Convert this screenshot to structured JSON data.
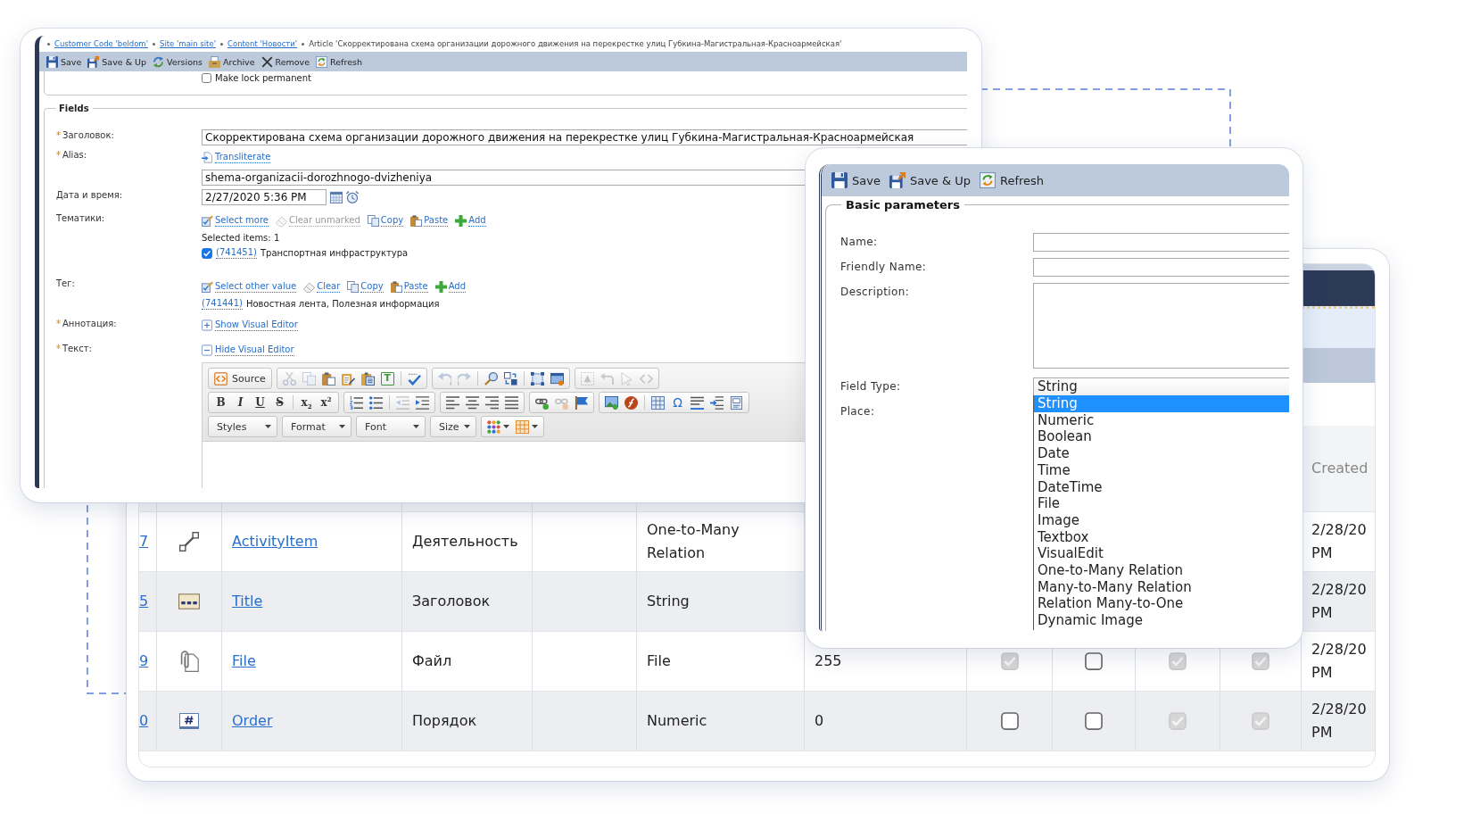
{
  "editor_window": {
    "breadcrumb": [
      {
        "label": "Customer Code 'beldom'",
        "link": true
      },
      {
        "label": "Site 'main site'",
        "link": true
      },
      {
        "label": "Content 'Новости'",
        "link": true
      },
      {
        "label": "Article 'Скорректирована схема организации дорожного движения на перекрестке улиц Губкина-Магистральная-Красноармейская'",
        "link": false
      }
    ],
    "toolbar": [
      {
        "kind": "save",
        "label": "Save"
      },
      {
        "kind": "save-up",
        "label": "Save & Up"
      },
      {
        "kind": "versions",
        "label": "Versions"
      },
      {
        "kind": "archive",
        "label": "Archive"
      },
      {
        "kind": "remove",
        "label": "Remove"
      },
      {
        "kind": "refresh",
        "label": "Refresh"
      }
    ],
    "lock": {
      "label": "Make lock permanent",
      "checked": false
    },
    "fields_legend": "Fields",
    "fields": [
      {
        "kind": "text",
        "label": "Заголовок:",
        "required": true,
        "value": "Скорректирована схема организации дорожного движения на перекрестке улиц Губкина-Магистральная-Красноармейская"
      },
      {
        "kind": "alias",
        "label": "Alias:",
        "required": true,
        "action": "Transliterate",
        "value": "shema-organizacii-dorozhnogo-dvizheniya"
      },
      {
        "kind": "datetime",
        "label": "Дата и время:",
        "required": false,
        "value": "2/27/2020 5:36 PM"
      },
      {
        "kind": "multi",
        "label": "Тематики:",
        "required": false,
        "actions": [
          {
            "kind": "select",
            "label": "Select more",
            "disabled": false
          },
          {
            "kind": "clear",
            "label": "Clear unmarked",
            "disabled": true
          },
          {
            "kind": "copy",
            "label": "Copy",
            "disabled": false
          },
          {
            "kind": "paste",
            "label": "Paste",
            "disabled": false
          },
          {
            "kind": "add",
            "label": "Add",
            "disabled": false
          }
        ],
        "summary": "Selected items: 1",
        "items": [
          {
            "checked": true,
            "number": "(741451)",
            "title": "Транспортная инфраструктура"
          }
        ]
      },
      {
        "kind": "single",
        "label": "Тег:",
        "required": false,
        "actions": [
          {
            "kind": "select",
            "label": "Select other value",
            "disabled": false
          },
          {
            "kind": "clear",
            "label": "Clear",
            "disabled": false
          },
          {
            "kind": "copy",
            "label": "Copy",
            "disabled": false
          },
          {
            "kind": "paste",
            "label": "Paste",
            "disabled": false
          },
          {
            "kind": "add",
            "label": "Add",
            "disabled": false
          }
        ],
        "value": {
          "number": "(741441)",
          "title": "Новостная лента, Полезная информация"
        }
      },
      {
        "kind": "visual",
        "label": "Аннотация:",
        "required": true,
        "expanded": false,
        "action": "Show Visual Editor"
      },
      {
        "kind": "visual",
        "label": "Текст:",
        "required": true,
        "expanded": true,
        "action": "Hide Visual Editor",
        "toolbar": [
          [
            [
              {
                "kind": "source",
                "label": "Source",
                "disabled": false
              }
            ],
            [
              {
                "kind": "cut",
                "disabled": true
              },
              {
                "kind": "copy",
                "disabled": true
              },
              {
                "kind": "paste",
                "disabled": false
              },
              {
                "kind": "paste-text",
                "disabled": false
              },
              {
                "kind": "paste-word",
                "disabled": false
              },
              {
                "kind": "template",
                "glyph": "T",
                "disabled": false
              },
              {
                "kind": "separator"
              },
              {
                "kind": "spellcheck",
                "disabled": false
              }
            ],
            [
              {
                "kind": "undo",
                "disabled": true
              },
              {
                "kind": "redo",
                "disabled": true
              },
              {
                "kind": "separator"
              },
              {
                "kind": "find",
                "disabled": false
              },
              {
                "kind": "replace",
                "disabled": false
              },
              {
                "kind": "separator"
              },
              {
                "kind": "select-all",
                "disabled": false
              },
              {
                "kind": "window",
                "disabled": false
              }
            ],
            [
              {
                "kind": "dotted-frame",
                "disabled": true
              },
              {
                "kind": "curved-arrow",
                "disabled": true
              },
              {
                "kind": "cursor",
                "disabled": true
              },
              {
                "kind": "code",
                "disabled": true
              }
            ]
          ],
          [
            [
              {
                "kind": "bold",
                "glyph": "B",
                "disabled": false
              },
              {
                "kind": "italic",
                "glyph": "I",
                "disabled": false
              },
              {
                "kind": "underline",
                "glyph": "U",
                "disabled": false
              },
              {
                "kind": "strike",
                "glyph": "S",
                "disabled": false
              },
              {
                "kind": "separator"
              },
              {
                "kind": "subscript",
                "glyph": "x$_{2}$",
                "disabled": false
              },
              {
                "kind": "superscript",
                "glyph": "x$^{2}$",
                "disabled": false
              }
            ],
            [
              {
                "kind": "numbered-list",
                "disabled": false
              },
              {
                "kind": "bullet-list",
                "disabled": false
              },
              {
                "kind": "separator"
              },
              {
                "kind": "outdent",
                "disabled": true
              },
              {
                "kind": "indent",
                "disabled": false
              }
            ],
            [
              {
                "kind": "align-left",
                "disabled": false
              },
              {
                "kind": "align-center",
                "disabled": false
              },
              {
                "kind": "align-right",
                "disabled": false
              },
              {
                "kind": "justify",
                "disabled": false
              }
            ],
            [
              {
                "kind": "link",
                "disabled": false
              },
              {
                "kind": "unlink",
                "disabled": true
              },
              {
                "kind": "anchor",
                "disabled": false
              }
            ],
            [
              {
                "kind": "image",
                "disabled": false
              },
              {
                "kind": "flash",
                "disabled": false
              },
              {
                "kind": "separator"
              },
              {
                "kind": "table",
                "disabled": false
              },
              {
                "kind": "special-char",
                "glyph": "Ω",
                "disabled": false
              },
              {
                "kind": "horizontal-rule",
                "disabled": false
              },
              {
                "kind": "page-break",
                "disabled": false
              },
              {
                "kind": "iframe",
                "disabled": false
              }
            ]
          ],
          [
            [
              {
                "kind": "dropdown",
                "label": "Styles",
                "disabled": false
              }
            ],
            [
              {
                "kind": "dropdown",
                "label": "Format",
                "disabled": false
              }
            ],
            [
              {
                "kind": "dropdown",
                "label": "Font",
                "disabled": false
              }
            ],
            [
              {
                "kind": "dropdown",
                "label": "Size",
                "disabled": false
              }
            ],
            [
              {
                "kind": "colors",
                "disabled": false
              },
              {
                "kind": "table-menu",
                "disabled": false
              }
            ]
          ]
        ]
      }
    ]
  },
  "fields_table": {
    "created_header": "Created",
    "rows": [
      {
        "column_1": "7",
        "kind": "relation",
        "column_3": "ActivityItem",
        "column_4": "Деятельность",
        "column_6": "One-to-Many Relation",
        "created": "2/28/20 PM"
      },
      {
        "column_1": "5",
        "kind": "string",
        "column_3": "Title",
        "column_4": "Заголовок",
        "column_6": "String",
        "created": "2/28/20 PM"
      },
      {
        "column_1": "9",
        "kind": "file",
        "column_3": "File",
        "column_4": "Файл",
        "column_6": "File",
        "column_7": "255",
        "checkboxes": [
          {
            "checked": true,
            "disabled": true
          },
          {
            "checked": false,
            "disabled": false
          },
          {
            "checked": true,
            "disabled": true
          },
          {
            "checked": true,
            "disabled": true
          }
        ],
        "created": "2/28/20 PM"
      },
      {
        "column_1": "0",
        "kind": "numeric",
        "column_3": "Order",
        "column_4": "Порядок",
        "column_6": "Numeric",
        "column_7": "0",
        "checkboxes": [
          {
            "checked": false,
            "disabled": false
          },
          {
            "checked": false,
            "disabled": false
          },
          {
            "checked": true,
            "disabled": true
          },
          {
            "checked": true,
            "disabled": true
          }
        ],
        "created": "2/28/20 PM"
      }
    ]
  },
  "field_dialog": {
    "toolbar": [
      {
        "kind": "save",
        "label": "Save"
      },
      {
        "kind": "save-up",
        "label": "Save & Up"
      },
      {
        "kind": "refresh",
        "label": "Refresh"
      }
    ],
    "legend": "Basic parameters",
    "fields": [
      {
        "kind": "input",
        "label": "Name:"
      },
      {
        "kind": "input",
        "label": "Friendly Name:"
      },
      {
        "kind": "textarea",
        "label": "Description:"
      },
      {
        "kind": "select",
        "label": "Field Type:",
        "value": "String",
        "expanded": true,
        "options": [
          {
            "label": "String",
            "selected": true
          },
          {
            "label": "Numeric",
            "selected": false
          },
          {
            "label": "Boolean",
            "selected": false
          },
          {
            "label": "Date",
            "selected": false
          },
          {
            "label": "Time",
            "selected": false
          },
          {
            "label": "DateTime",
            "selected": false
          },
          {
            "label": "File",
            "selected": false
          },
          {
            "label": "Image",
            "selected": false
          },
          {
            "label": "Textbox",
            "selected": false
          },
          {
            "label": "VisualEdit",
            "selected": false
          },
          {
            "label": "One-to-Many Relation",
            "selected": false
          },
          {
            "label": "Many-to-Many Relation",
            "selected": false
          },
          {
            "label": "Relation Many-to-One",
            "selected": false
          },
          {
            "label": "Dynamic Image",
            "selected": false
          }
        ]
      },
      {
        "kind": "plain",
        "label": "Place:"
      }
    ]
  }
}
